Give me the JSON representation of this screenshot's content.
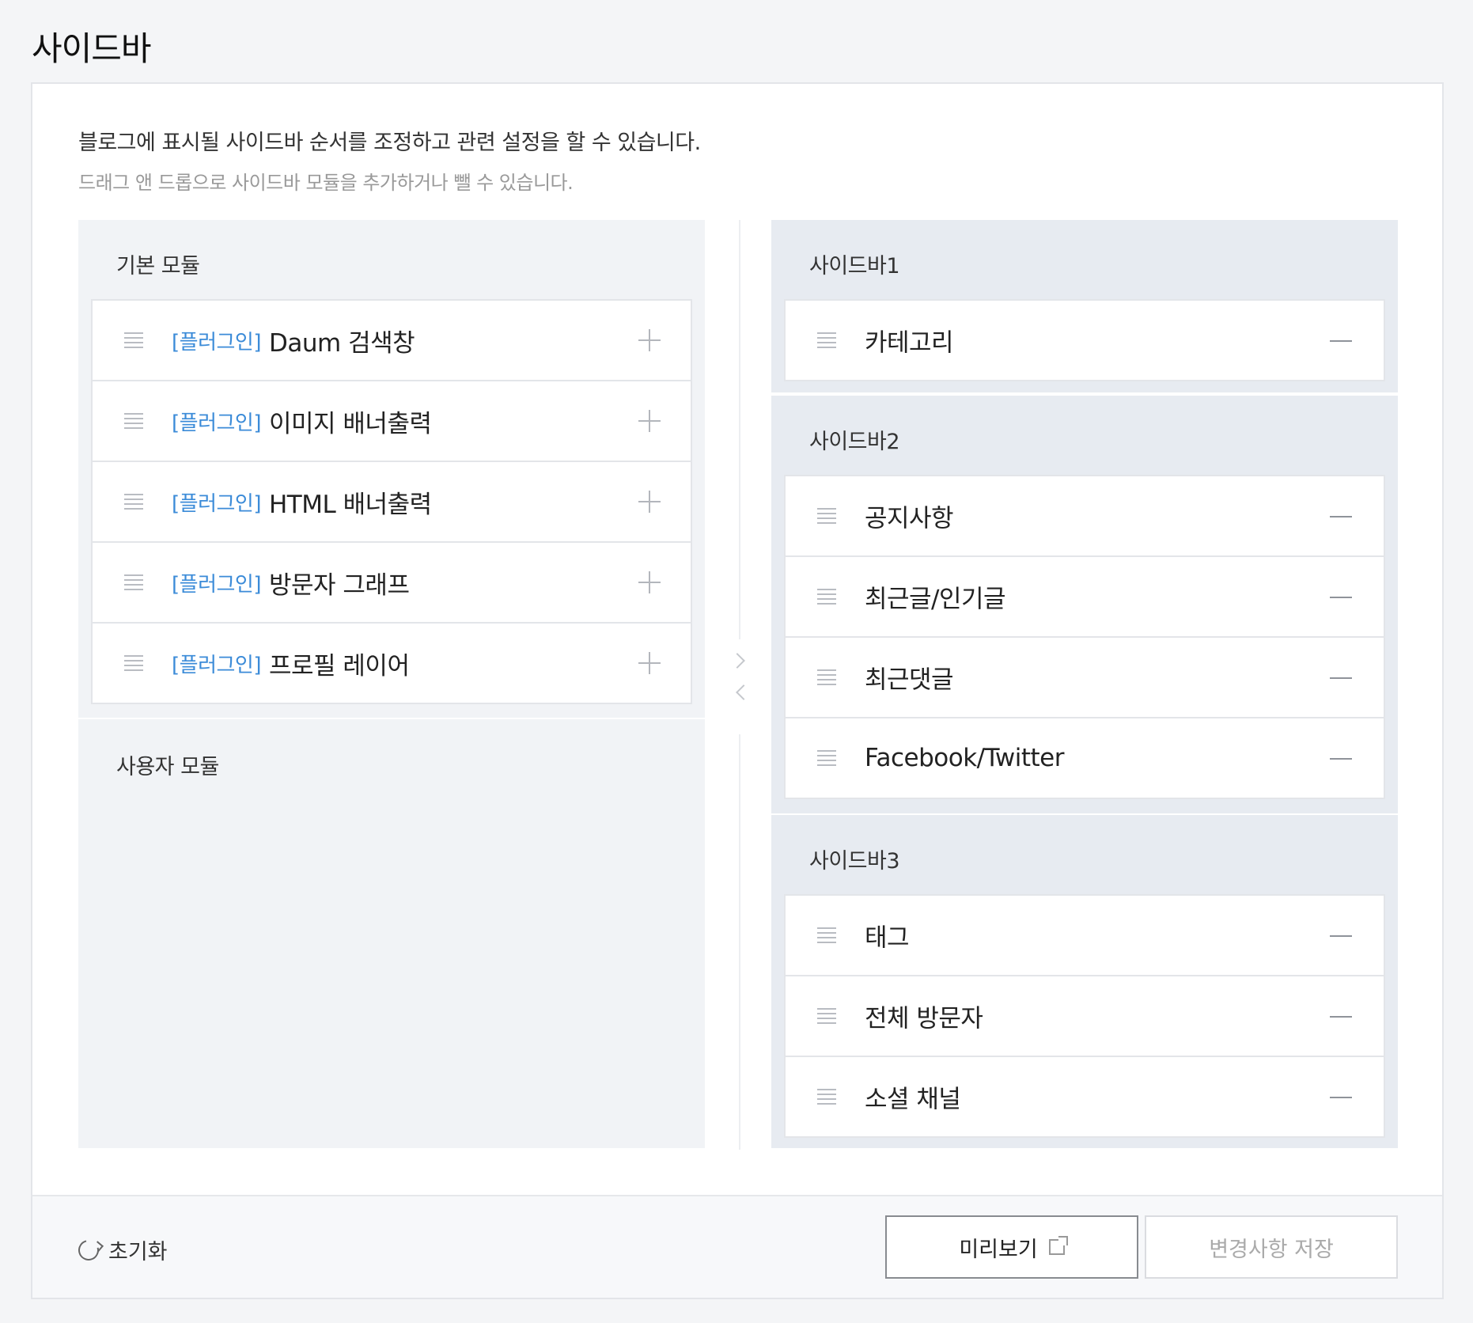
{
  "page": {
    "title": "사이드바"
  },
  "description": {
    "main": "블로그에 표시될 사이드바 순서를 조정하고 관련 설정을 할 수 있습니다.",
    "sub": "드래그 앤 드롭으로 사이드바 모듈을 추가하거나 뺄 수 있습니다."
  },
  "basic_modules": {
    "title": "기본 모듈",
    "items": [
      {
        "tag": "[플러그인]",
        "name": "Daum 검색창"
      },
      {
        "tag": "[플러그인]",
        "name": "이미지 배너출력"
      },
      {
        "tag": "[플러그인]",
        "name": "HTML 배너출력"
      },
      {
        "tag": "[플러그인]",
        "name": "방문자 그래프"
      },
      {
        "tag": "[플러그인]",
        "name": "프로필 레이어"
      }
    ]
  },
  "user_modules": {
    "title": "사용자 모듈"
  },
  "sidebars": [
    {
      "title": "사이드바1",
      "items": [
        "카테고리"
      ]
    },
    {
      "title": "사이드바2",
      "items": [
        "공지사항",
        "최근글/인기글",
        "최근댓글",
        "Facebook/Twitter"
      ]
    },
    {
      "title": "사이드바3",
      "items": [
        "태그",
        "전체 방문자",
        "소셜 채널"
      ]
    }
  ],
  "footer": {
    "reset_label": "초기화",
    "preview_label": "미리보기",
    "save_label": "변경사항 저장"
  },
  "icons": {
    "drag": "drag-handle-icon",
    "add": "plus-icon",
    "remove": "minus-icon",
    "reset": "refresh-icon",
    "external": "external-link-icon",
    "move_right": "chevron-right-icon",
    "move_left": "chevron-left-icon"
  },
  "colors": {
    "plugin_tag": "#3b8bd8",
    "sidebar_panel": "#e7ebf1",
    "module_panel": "#f1f3f6"
  }
}
